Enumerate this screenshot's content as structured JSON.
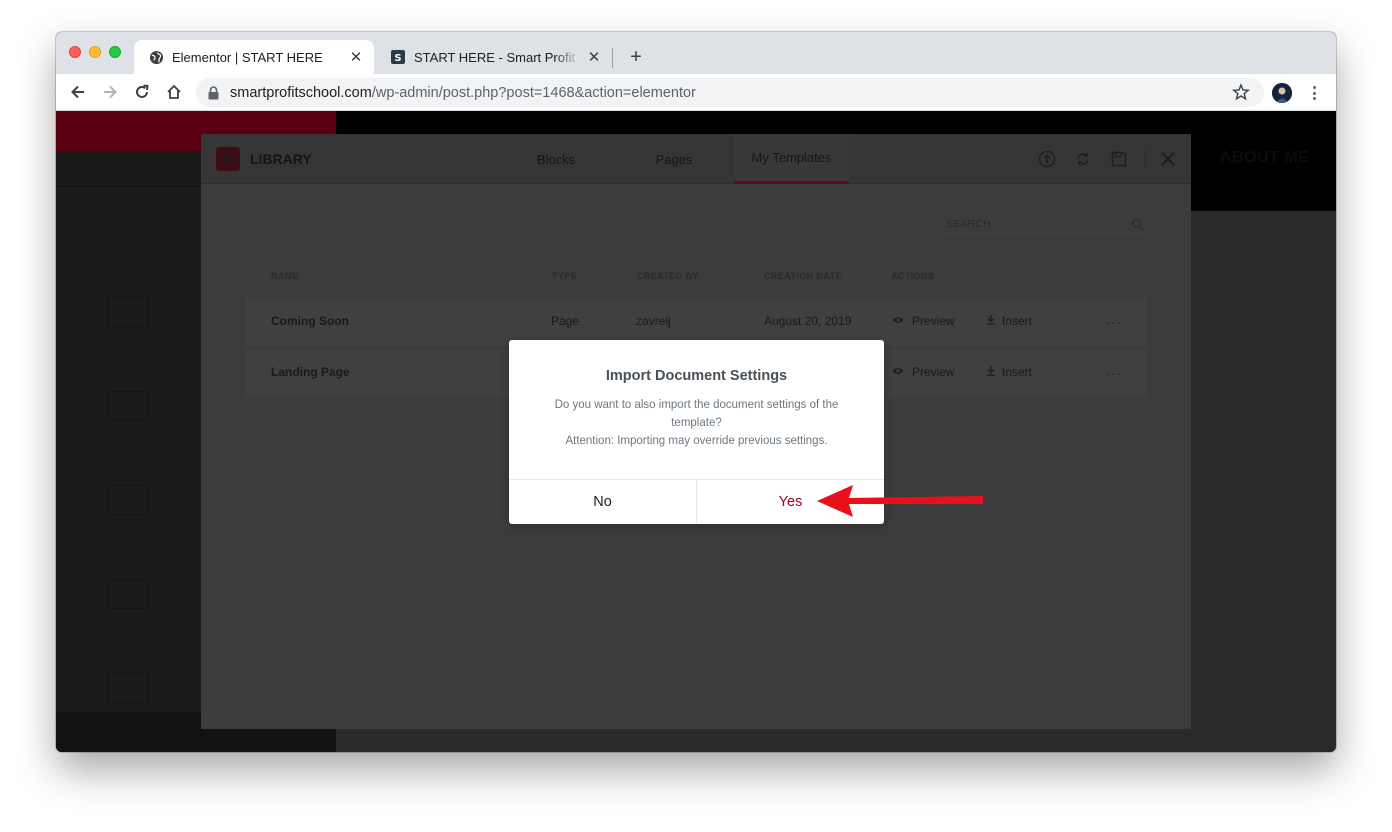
{
  "browser": {
    "tabs": [
      {
        "title": "Elementor | START HERE",
        "favicon": "globe-icon",
        "active": true
      },
      {
        "title": "START HERE - Smart Profit School",
        "favicon": "site-favicon-icon",
        "active": false
      }
    ],
    "close_glyph": "✕",
    "new_tab_glyph": "+",
    "url": {
      "host": "smartprofitschool.com",
      "path": "/wp-admin/post.php?post=1468&action=elementor"
    }
  },
  "page": {
    "nav_item": "ABOUT ME"
  },
  "library": {
    "title": "LIBRARY",
    "tabs": [
      {
        "label": "Blocks",
        "active": false
      },
      {
        "label": "Pages",
        "active": false
      },
      {
        "label": "My Templates",
        "active": true
      }
    ],
    "search_label": "SEARCH",
    "columns": {
      "name": "NAME",
      "type": "TYPE",
      "created_by": "CREATED BY",
      "creation_date": "CREATION DATE",
      "actions": "ACTIONS"
    },
    "rows": [
      {
        "name": "Coming Soon",
        "type": "Page",
        "created_by": "zavreij",
        "creation_date": "August 20, 2019",
        "preview": "Preview",
        "insert": "Insert",
        "more": "···"
      },
      {
        "name": "Landing Page",
        "type": "",
        "created_by": "",
        "creation_date": "",
        "preview": "Preview",
        "insert": "Insert",
        "more": "···"
      }
    ]
  },
  "dialog": {
    "title": "Import Document Settings",
    "message_line1": "Do you want to also import the document settings of the template?",
    "message_line2": "Attention: Importing may override previous settings.",
    "no_label": "No",
    "yes_label": "Yes"
  },
  "colors": {
    "accent": "#a4001f",
    "arrow": "#e8101a",
    "brand": "#5c0a16"
  }
}
